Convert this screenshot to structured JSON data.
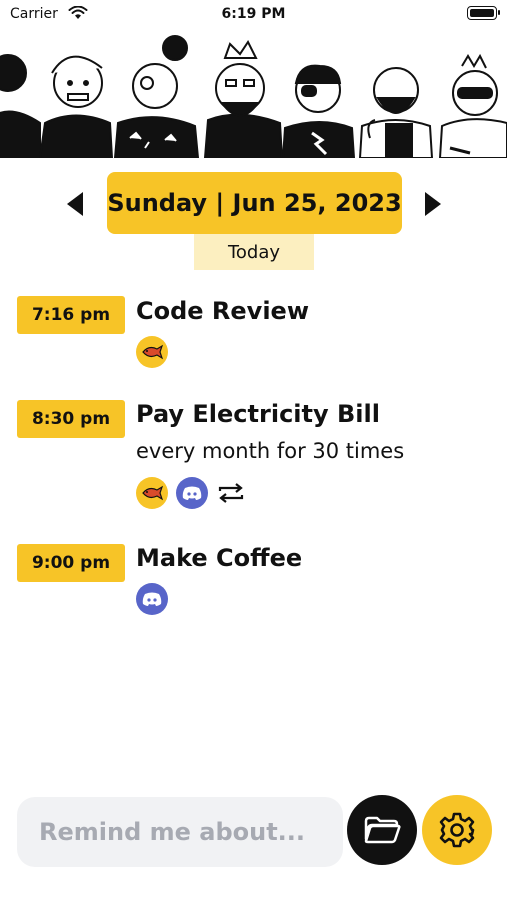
{
  "status_bar": {
    "carrier": "Carrier",
    "time": "6:19 PM"
  },
  "header": {
    "date_label": "Sunday | Jun 25, 2023",
    "today_label": "Today"
  },
  "tasks": [
    {
      "time": "7:16 pm",
      "title": "Code Review",
      "subtitle": "",
      "icons": [
        "fish-icon"
      ]
    },
    {
      "time": "8:30 pm",
      "title": "Pay Electricity Bill",
      "subtitle": "every month for 30 times",
      "icons": [
        "fish-icon",
        "discord-icon",
        "repeat-icon"
      ]
    },
    {
      "time": "9:00 pm",
      "title": "Make Coffee",
      "subtitle": "",
      "icons": [
        "discord-icon"
      ]
    }
  ],
  "composer": {
    "placeholder": "Remind me about..."
  },
  "colors": {
    "accent": "#f7c427",
    "accent_light": "#fcefc0",
    "discord": "#5865c9",
    "input_bg": "#f1f2f4"
  }
}
